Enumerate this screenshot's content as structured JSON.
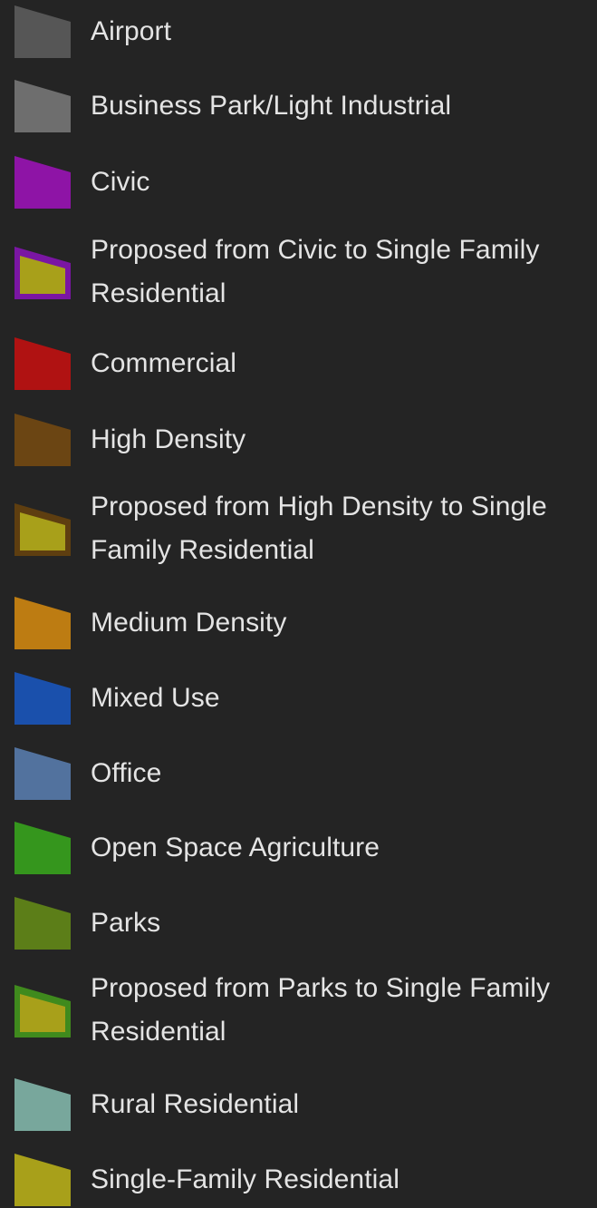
{
  "legend": {
    "items": [
      {
        "label": "Airport",
        "fill": "#565656",
        "outline": "#565656",
        "proposed": false
      },
      {
        "label": "Business Park/Light Industrial",
        "fill": "#6e6e6e",
        "outline": "#6e6e6e",
        "proposed": false
      },
      {
        "label": "Civic",
        "fill": "#8e14a6",
        "outline": "#8e14a6",
        "proposed": false
      },
      {
        "label": "Proposed from Civic to Single Family Residential",
        "fill": "#a8a01a",
        "outline": "#7a16a3",
        "proposed": true
      },
      {
        "label": "Commercial",
        "fill": "#b01212",
        "outline": "#b01212",
        "proposed": false
      },
      {
        "label": "High Density",
        "fill": "#6b4513",
        "outline": "#6b4513",
        "proposed": false
      },
      {
        "label": "Proposed from High Density to Single Family Residential",
        "fill": "#a8a01a",
        "outline": "#5e3e10",
        "proposed": true
      },
      {
        "label": "Medium Density",
        "fill": "#bd7c12",
        "outline": "#bd7c12",
        "proposed": false
      },
      {
        "label": "Mixed Use",
        "fill": "#1a50ac",
        "outline": "#1a50ac",
        "proposed": false
      },
      {
        "label": "Office",
        "fill": "#52729e",
        "outline": "#52729e",
        "proposed": false
      },
      {
        "label": "Open Space Agriculture",
        "fill": "#35961d",
        "outline": "#35961d",
        "proposed": false
      },
      {
        "label": "Parks",
        "fill": "#5c7e18",
        "outline": "#5c7e18",
        "proposed": false
      },
      {
        "label": "Proposed from Parks to Single Family Residential",
        "fill": "#a8a01a",
        "outline": "#3f8a1d",
        "proposed": true
      },
      {
        "label": "Rural Residential",
        "fill": "#78a79c",
        "outline": "#78a79c",
        "proposed": false
      },
      {
        "label": "Single-Family Residential",
        "fill": "#a8a01a",
        "outline": "#a8a01a",
        "proposed": false
      }
    ]
  }
}
